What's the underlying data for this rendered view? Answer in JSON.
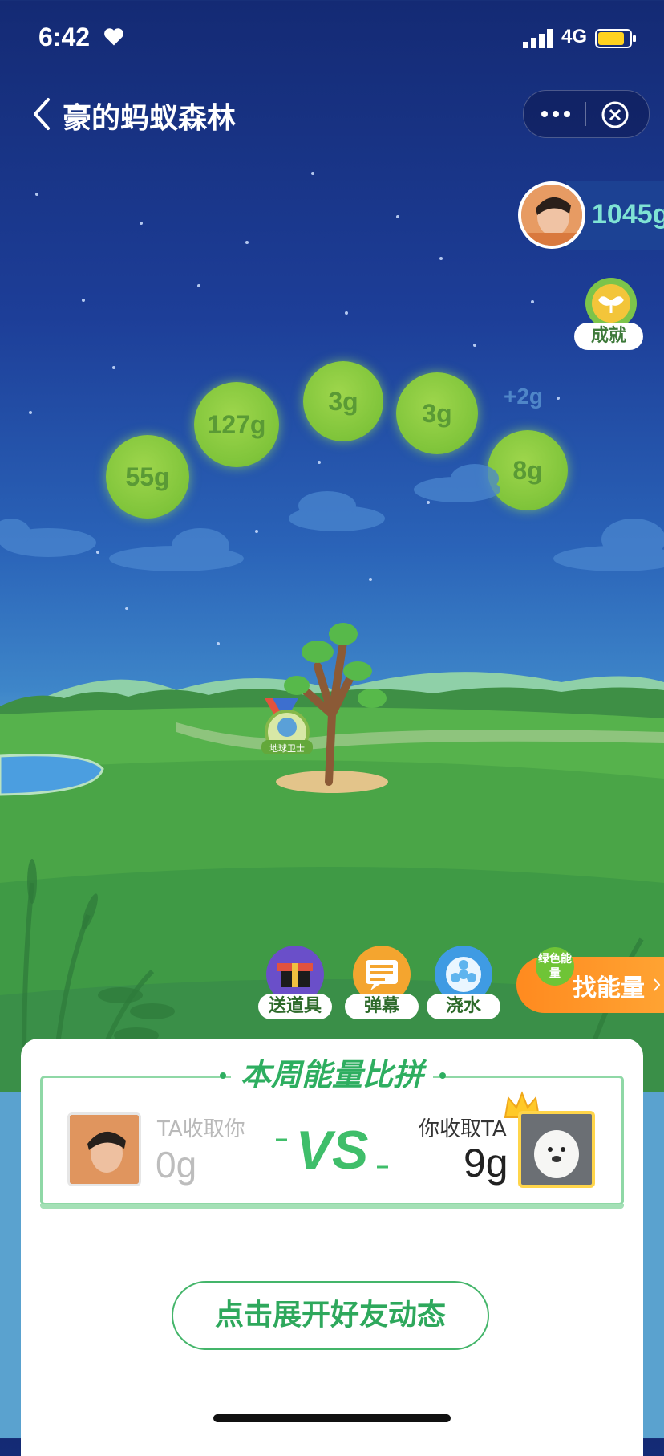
{
  "status_bar": {
    "time": "6:42",
    "network": "4G"
  },
  "nav": {
    "title": "豪的蚂蚁森林"
  },
  "user": {
    "energy": "1045g"
  },
  "achievement": {
    "label": "成就"
  },
  "energy_balls": [
    "55g",
    "127g",
    "3g",
    "3g",
    "8g"
  ],
  "plus_energy": "+2g",
  "medal_text": "地球卫士",
  "actions": [
    {
      "label": "送道具",
      "icon": "gift-icon"
    },
    {
      "label": "弹幕",
      "icon": "comment-icon"
    },
    {
      "label": "浇水",
      "icon": "water-icon"
    }
  ],
  "find_energy": {
    "badge": "绿色能量",
    "label": "找能量"
  },
  "pk": {
    "title": "本周能量比拼",
    "ta_label": "TA收取你",
    "ta_value": "0g",
    "vs": "VS",
    "me_label": "你收取TA",
    "me_value": "9g"
  },
  "expand_button": "点击展开好友动态",
  "colors": {
    "accent": "#2eae60",
    "energy_ball": "#8cce43",
    "find_energy": "#ff8a1f"
  }
}
